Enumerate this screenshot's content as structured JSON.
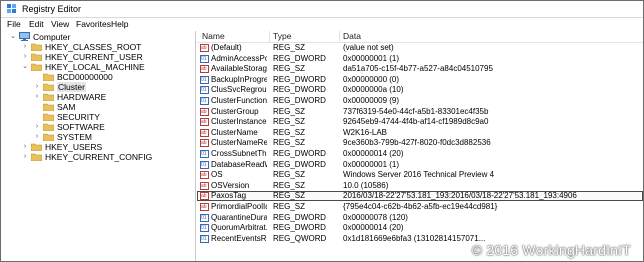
{
  "window": {
    "title": "Registry Editor"
  },
  "menu": [
    "File",
    "Edit",
    "View",
    "Favorites",
    "Help"
  ],
  "tree": [
    {
      "label": "Computer",
      "level": 0,
      "arrow": "v",
      "icon": "computer-icon"
    },
    {
      "label": "HKEY_CLASSES_ROOT",
      "level": 1,
      "arrow": ">"
    },
    {
      "label": "HKEY_CURRENT_USER",
      "level": 1,
      "arrow": ">"
    },
    {
      "label": "HKEY_LOCAL_MACHINE",
      "level": 1,
      "arrow": "v"
    },
    {
      "label": "BCD00000000",
      "level": 2,
      "arrow": ""
    },
    {
      "label": "Cluster",
      "level": 2,
      "arrow": ">",
      "selected": true
    },
    {
      "label": "HARDWARE",
      "level": 2,
      "arrow": ">"
    },
    {
      "label": "SAM",
      "level": 2,
      "arrow": ""
    },
    {
      "label": "SECURITY",
      "level": 2,
      "arrow": ""
    },
    {
      "label": "SOFTWARE",
      "level": 2,
      "arrow": ">"
    },
    {
      "label": "SYSTEM",
      "level": 2,
      "arrow": ">"
    },
    {
      "label": "HKEY_USERS",
      "level": 1,
      "arrow": ">"
    },
    {
      "label": "HKEY_CURRENT_CONFIG",
      "level": 1,
      "arrow": ">"
    }
  ],
  "columns": {
    "name": "Name",
    "type": "Type",
    "data": "Data"
  },
  "values": [
    {
      "name": "(Default)",
      "type": "REG_SZ",
      "data": "(value not set)"
    },
    {
      "name": "AdminAccessPo...",
      "type": "REG_DWORD",
      "data": "0x00000001 (1)"
    },
    {
      "name": "AvailableStorage",
      "type": "REG_SZ",
      "data": "da51a705-c15f-4b77-a527-a84c04510795"
    },
    {
      "name": "BackupInProgress",
      "type": "REG_DWORD",
      "data": "0x00000000 (0)"
    },
    {
      "name": "ClusSvcRegroup...",
      "type": "REG_DWORD",
      "data": "0x0000000a (10)"
    },
    {
      "name": "ClusterFunction...",
      "type": "REG_DWORD",
      "data": "0x00000009 (9)"
    },
    {
      "name": "ClusterGroup",
      "type": "REG_SZ",
      "data": "737f6319-54e0-44cf-a5b1-83301ec4f35b"
    },
    {
      "name": "ClusterInstanceID",
      "type": "REG_SZ",
      "data": "92645eb9-4744-4f4b-af14-cf1989d8c9a0"
    },
    {
      "name": "ClusterName",
      "type": "REG_SZ",
      "data": "W2K16-LAB"
    },
    {
      "name": "ClusterNameRe...",
      "type": "REG_SZ",
      "data": "9ce360b3-799b-427f-8020-f0dc3d882536"
    },
    {
      "name": "CrossSubnetThr...",
      "type": "REG_DWORD",
      "data": "0x00000014 (20)"
    },
    {
      "name": "DatabaseReadW...",
      "type": "REG_DWORD",
      "data": "0x00000001 (1)"
    },
    {
      "name": "OS",
      "type": "REG_SZ",
      "data": "Windows Server 2016 Technical Preview 4"
    },
    {
      "name": "OSVersion",
      "type": "REG_SZ",
      "data": "10.0 (10586)"
    },
    {
      "name": "PaxosTag",
      "type": "REG_SZ",
      "data": "2016/03/18-22'27'53.181_193:2016/03/18-22'27'53.181_193:4906",
      "selected": true
    },
    {
      "name": "PrimordialPoolId",
      "type": "REG_SZ",
      "data": "{795e4c04-c62b-4b62-a5fb-ec19e44cd981}"
    },
    {
      "name": "QuarantineDura...",
      "type": "REG_DWORD",
      "data": "0x00000078 (120)"
    },
    {
      "name": "QuorumArbitrat...",
      "type": "REG_DWORD",
      "data": "0x00000014 (20)"
    },
    {
      "name": "RecentEventsRe...",
      "type": "REG_QWORD",
      "data": "0x1d181669e6bfa3 (13102814157071..."
    }
  ],
  "watermark": "© 2016 WorkingHardInIT",
  "colors": {
    "folder": "#e8c15a",
    "string_icon": "#b23b3b",
    "dword_icon": "#3a67b5"
  }
}
